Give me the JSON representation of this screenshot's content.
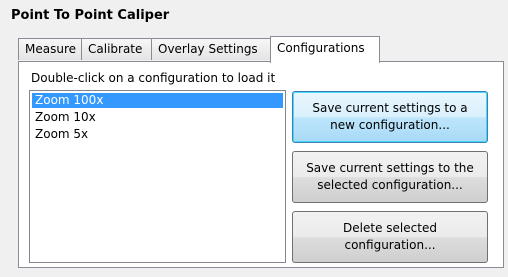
{
  "window": {
    "title": "Point To Point Caliper"
  },
  "tabs": [
    {
      "label": "Measure",
      "active": false
    },
    {
      "label": "Calibrate",
      "active": false
    },
    {
      "label": "Overlay Settings",
      "active": false
    },
    {
      "label": "Configurations",
      "active": true
    }
  ],
  "configurations": {
    "instruction": "Double-click on a configuration to load it",
    "items": [
      "Zoom 100x",
      "Zoom 10x",
      "Zoom 5x"
    ],
    "selected_index": 0
  },
  "buttons": {
    "save_new": "Save current settings to a\nnew configuration...",
    "save_selected": "Save current settings to the\nselected configuration...",
    "delete": "Delete selected\nconfiguration..."
  },
  "colors": {
    "selection": "#3399ff",
    "default_button_border": "#3c7fb1"
  }
}
